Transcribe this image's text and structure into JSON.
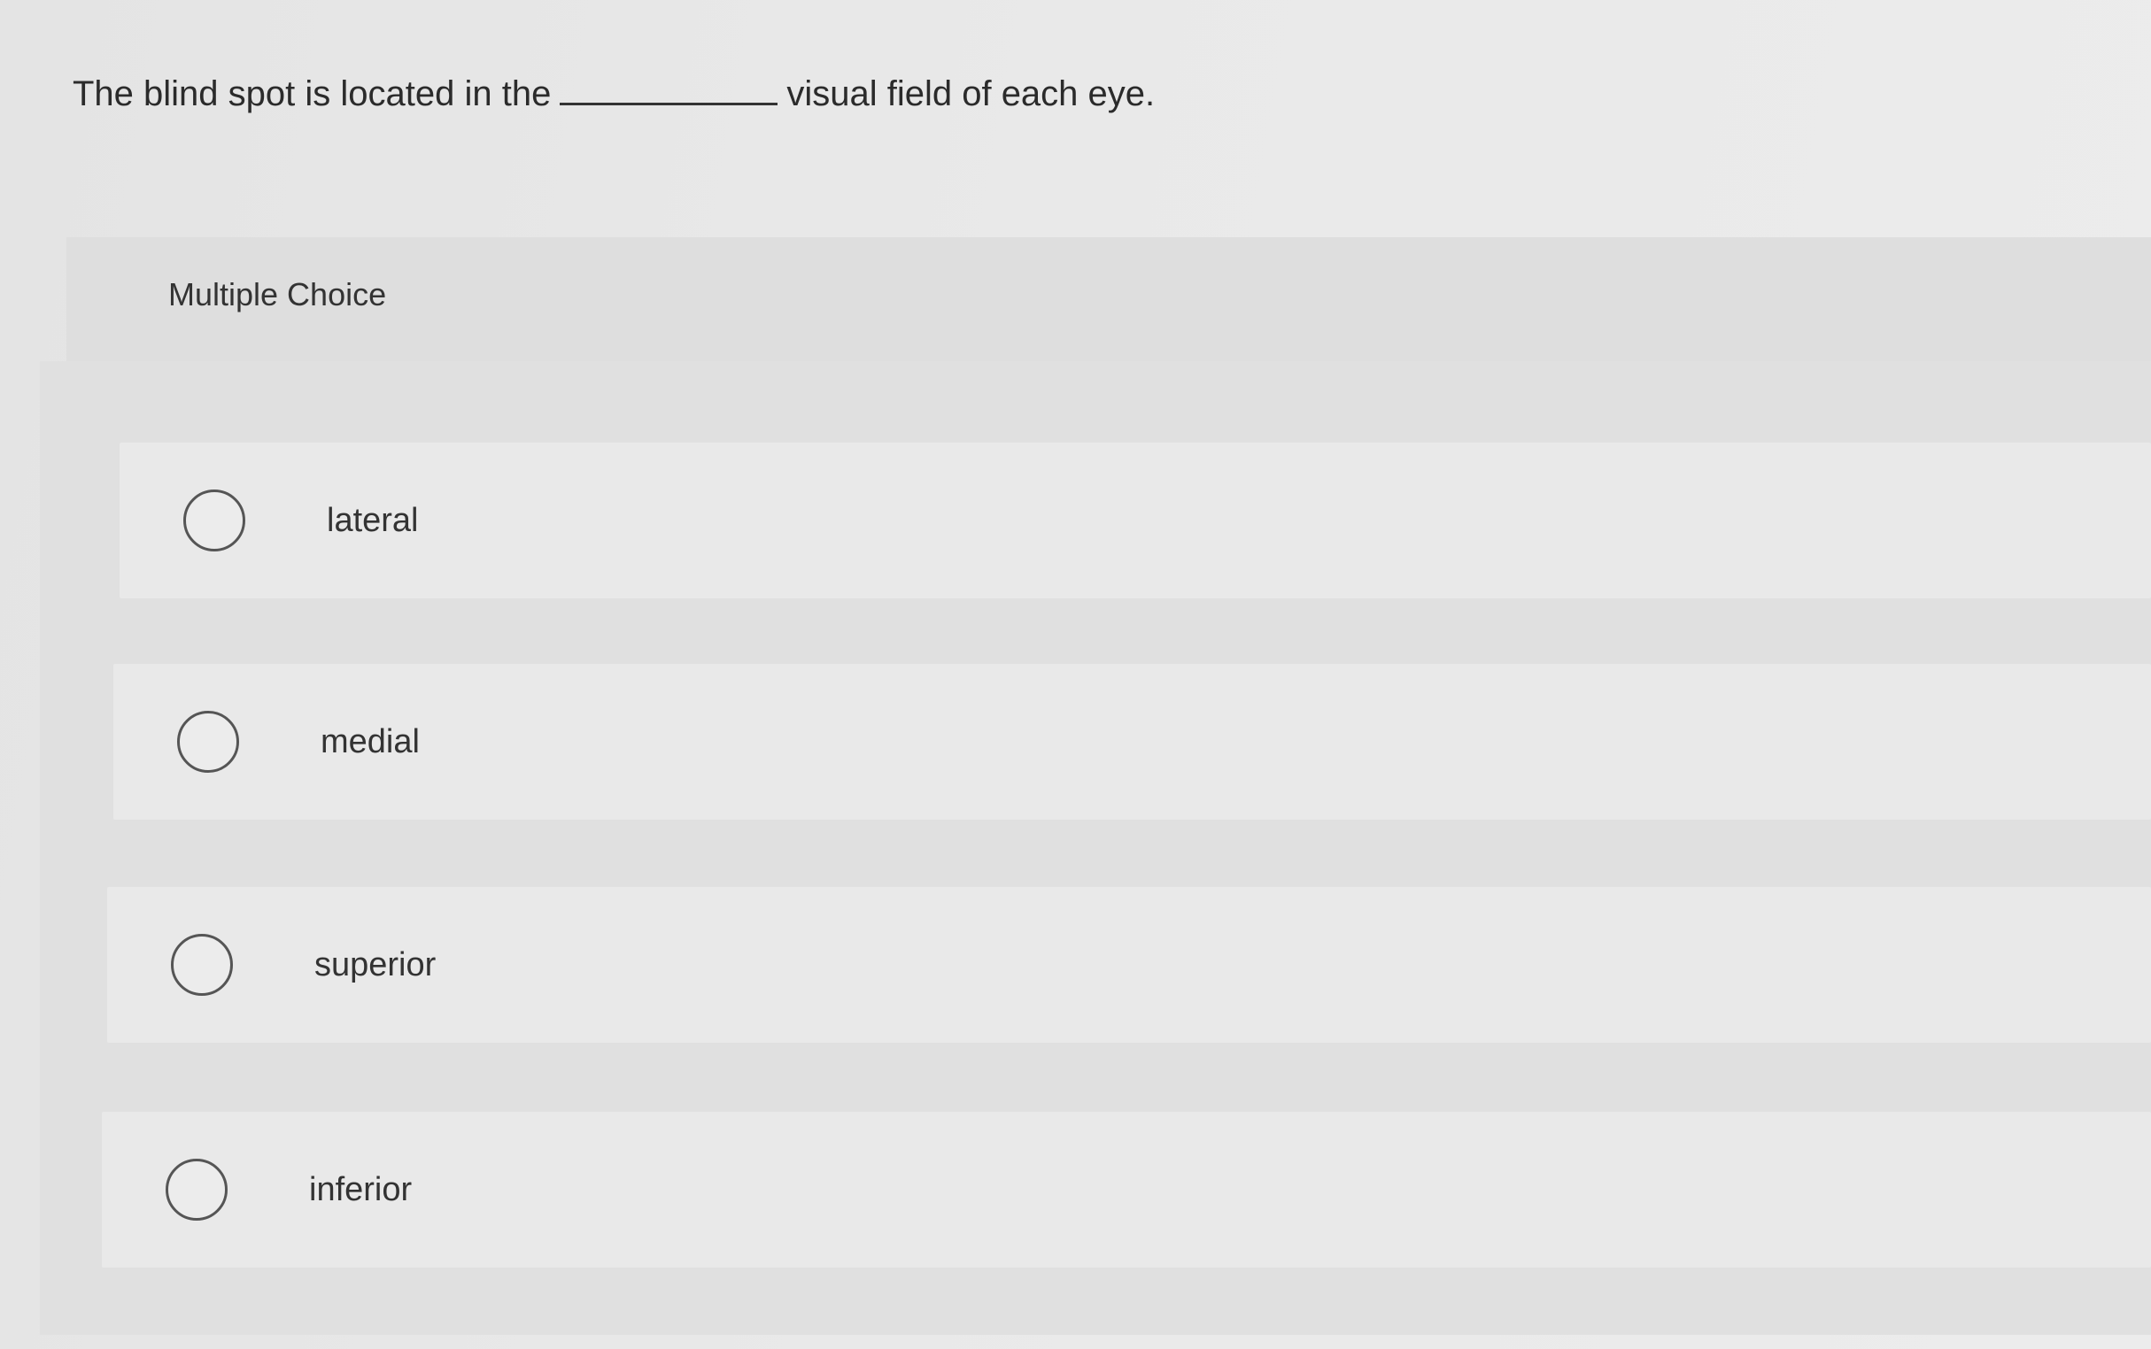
{
  "question": {
    "before_blank": "The blind spot is located in the",
    "after_blank": "visual field of each eye."
  },
  "multiple_choice": {
    "label": "Multiple Choice",
    "options": [
      {
        "label": "lateral"
      },
      {
        "label": "medial"
      },
      {
        "label": "superior"
      },
      {
        "label": "inferior"
      }
    ]
  }
}
